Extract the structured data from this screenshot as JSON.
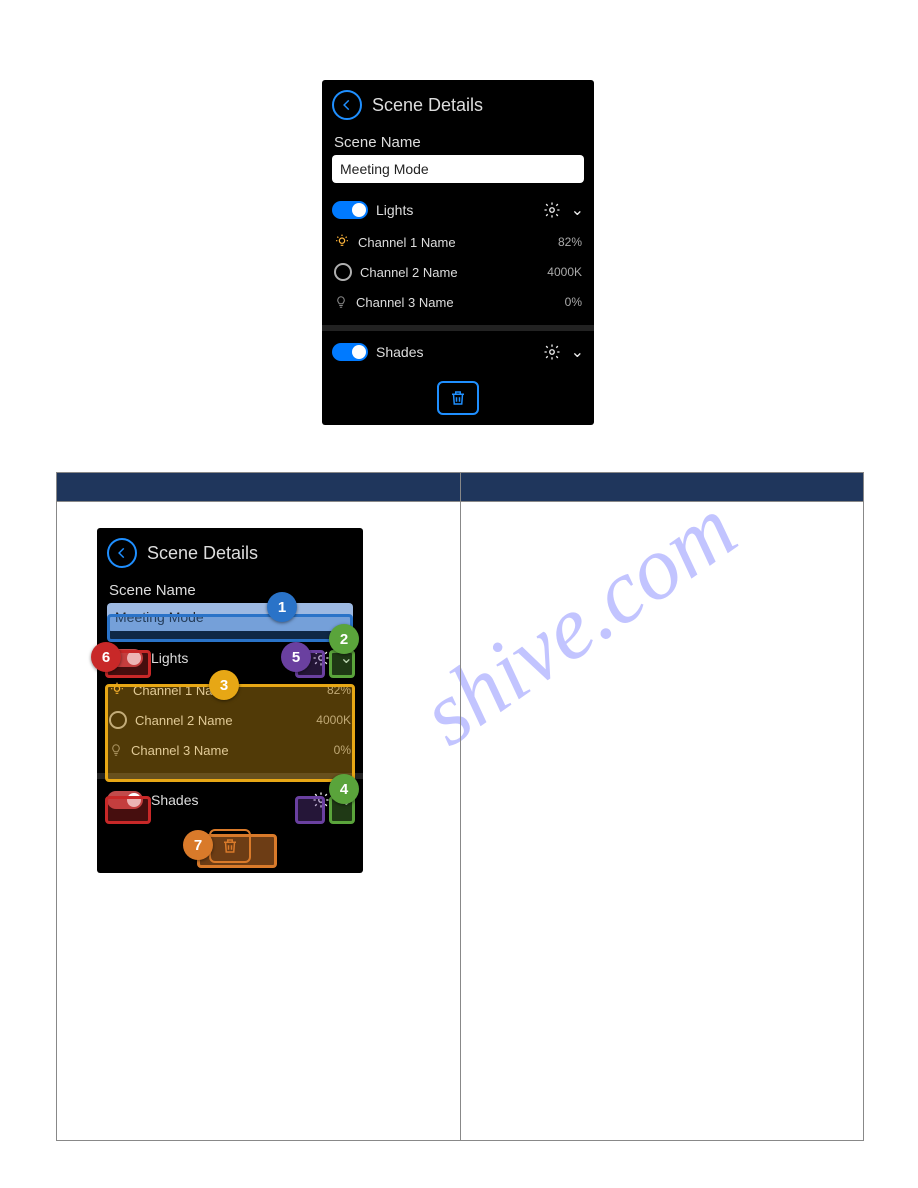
{
  "watermark": "shive.com",
  "app": {
    "title": "Scene Details",
    "scene_name_label": "Scene Name",
    "scene_name_value": "Meeting Mode"
  },
  "lights": {
    "label": "Lights",
    "channels": [
      {
        "name": "Channel 1 Name",
        "value": "82%"
      },
      {
        "name": "Channel 2 Name",
        "value": "4000K"
      },
      {
        "name": "Channel 3 Name",
        "value": "0%"
      }
    ]
  },
  "shades": {
    "label": "Shades"
  },
  "callouts": {
    "m1": "1",
    "m2": "2",
    "m3": "3",
    "m4": "4",
    "m5": "5",
    "m6": "6",
    "m7": "7"
  }
}
